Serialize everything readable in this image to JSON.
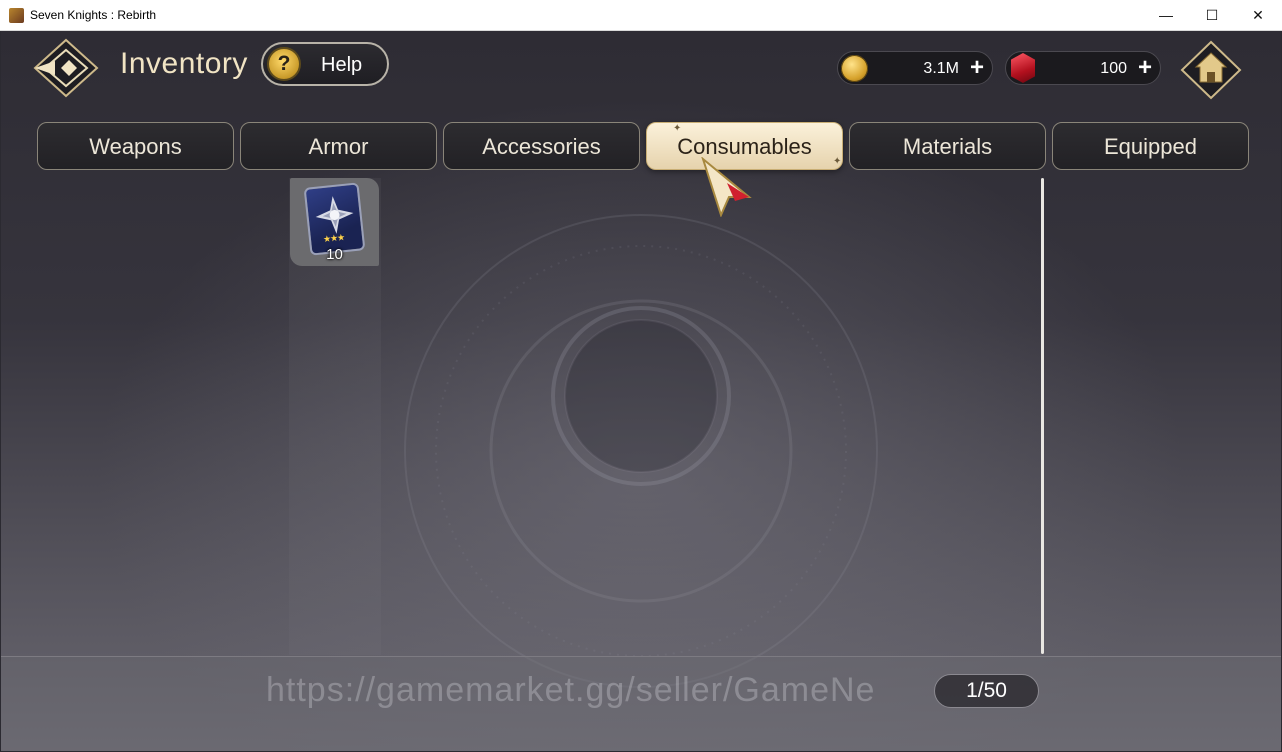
{
  "window": {
    "title": "Seven Knights : Rebirth",
    "controls": {
      "minimize": "—",
      "maximize": "☐",
      "close": "✕"
    }
  },
  "header": {
    "title": "Inventory",
    "help_label": "Help",
    "help_icon_glyph": "?",
    "gold_value": "3.1M",
    "gem_value": "100",
    "plus_glyph": "+"
  },
  "tabs": [
    {
      "label": "Weapons",
      "active": false
    },
    {
      "label": "Armor",
      "active": false
    },
    {
      "label": "Accessories",
      "active": false
    },
    {
      "label": "Consumables",
      "active": true
    },
    {
      "label": "Materials",
      "active": false
    },
    {
      "label": "Equipped",
      "active": false
    }
  ],
  "inventory": {
    "items": [
      {
        "icon": "star-card-icon",
        "stars": "★★★",
        "count": "10"
      }
    ]
  },
  "footer": {
    "watermark": "https://gamemarket.gg/seller/GameNe",
    "page_counter": "1/50"
  },
  "colors": {
    "accent_gold": "#f1e4c4",
    "active_tab": "#fbf1da",
    "gem_red": "#d01a2a"
  }
}
